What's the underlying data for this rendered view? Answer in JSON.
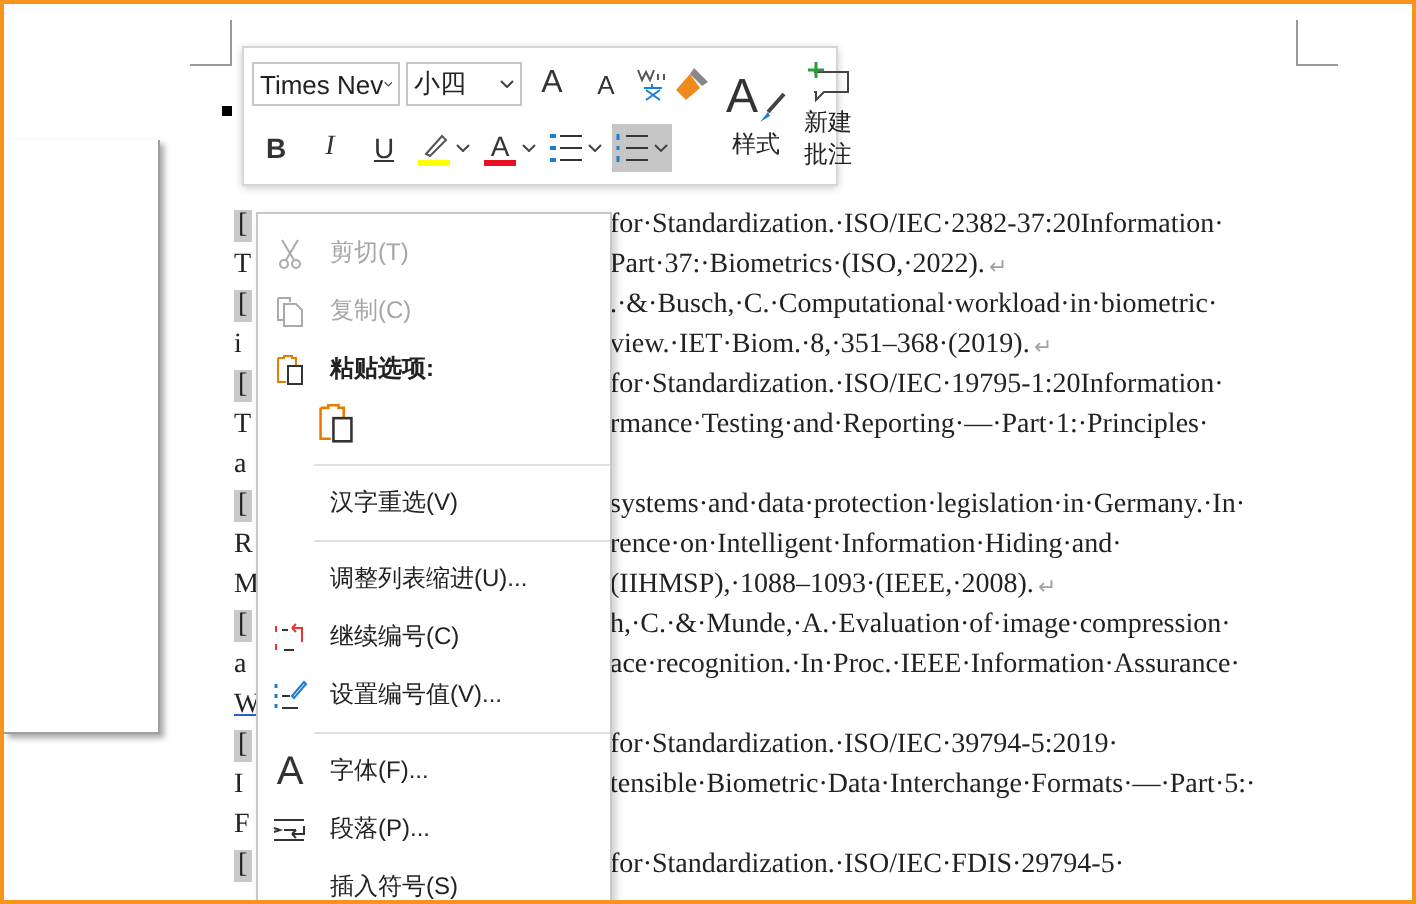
{
  "toolbar": {
    "font_name": "Times Nev",
    "font_size": "小四",
    "grow_font": "A",
    "shrink_font": "A",
    "bold": "B",
    "italic": "I",
    "underline": "U",
    "font_color": "A",
    "styles_glyph": "A",
    "styles_label": "样式",
    "new_comment": "新建批注",
    "list_buttons": [
      {
        "kind": "bullets",
        "selected": false
      },
      {
        "kind": "numbering",
        "selected": true
      }
    ]
  },
  "document": {
    "lines": [
      {
        "left": "[",
        "field": true,
        "text": "for·Standardization.·ISO/IEC·2382-37:20Information·"
      },
      {
        "left": "T",
        "field": false,
        "text": "Part·37:·Biometrics·(ISO,·2022).",
        "mark": "↵"
      },
      {
        "left": "[",
        "field": true,
        "text": ".·&·Busch,·C.·Computational·workload·in·biometric·"
      },
      {
        "left": "i",
        "field": false,
        "text": "view.·IET·Biom.·8,·351–368·(2019).",
        "mark": "↵"
      },
      {
        "left": "[",
        "field": true,
        "text": "for·Standardization.·ISO/IEC·19795-1:20Information·"
      },
      {
        "left": "T",
        "field": false,
        "text": "rmance·Testing·and·Reporting·—·Part·1:·Principles·"
      },
      {
        "left": "a",
        "field": false
      },
      {
        "left": "[",
        "field": true,
        "text": "systems·and·data·protection·legislation·in·Germany.·In·"
      },
      {
        "left": "R",
        "field": false,
        "text": "rence·on·Intelligent·Information·Hiding·and·"
      },
      {
        "left": "M",
        "field": false,
        "text": "(IIHMSP),·1088–1093·(IEEE,·2008).",
        "mark": "↵"
      },
      {
        "left": "[",
        "field": true,
        "text": "h,·C.·&·Munde,·A.·Evaluation·of·image·compression·"
      },
      {
        "left": "a",
        "field": false,
        "text": "ace·recognition.·In·Proc.·IEEE·Information·Assurance·"
      },
      {
        "left": "W",
        "field": false,
        "link": true
      },
      {
        "left": "[",
        "field": true,
        "text": "for·Standardization.·ISO/IEC·39794-5:2019·"
      },
      {
        "left": "I",
        "field": false,
        "text": "tensible·Biometric·Data·Interchange·Formats·—·Part·5:·"
      },
      {
        "left": "F",
        "field": false
      },
      {
        "left": "[",
        "field": true,
        "text": "for·Standardization.·ISO/IEC·FDIS·29794-5·"
      }
    ]
  },
  "context_menu": {
    "items": [
      {
        "kind": "cut",
        "label": "剪切(T)",
        "disabled": true
      },
      {
        "kind": "copy",
        "label": "复制(C)",
        "disabled": true
      },
      {
        "kind": "header",
        "label": "粘贴选项:"
      },
      {
        "kind": "paste-option"
      },
      {
        "kind": "separator"
      },
      {
        "kind": "plain",
        "label": "汉字重选(V)",
        "disabled": false
      },
      {
        "kind": "separator"
      },
      {
        "kind": "plain",
        "label": "调整列表缩进(U)...",
        "disabled": false
      },
      {
        "kind": "continue-numbering",
        "label": "继续编号(C)",
        "disabled": false
      },
      {
        "kind": "set-numbering",
        "label": "设置编号值(V)...",
        "disabled": false
      },
      {
        "kind": "separator"
      },
      {
        "kind": "font",
        "glyph": "A",
        "label": "字体(F)...",
        "disabled": false
      },
      {
        "kind": "paragraph",
        "label": "段落(P)...",
        "disabled": false
      },
      {
        "kind": "plain",
        "label": "插入符号(S)",
        "disabled": false
      }
    ]
  }
}
